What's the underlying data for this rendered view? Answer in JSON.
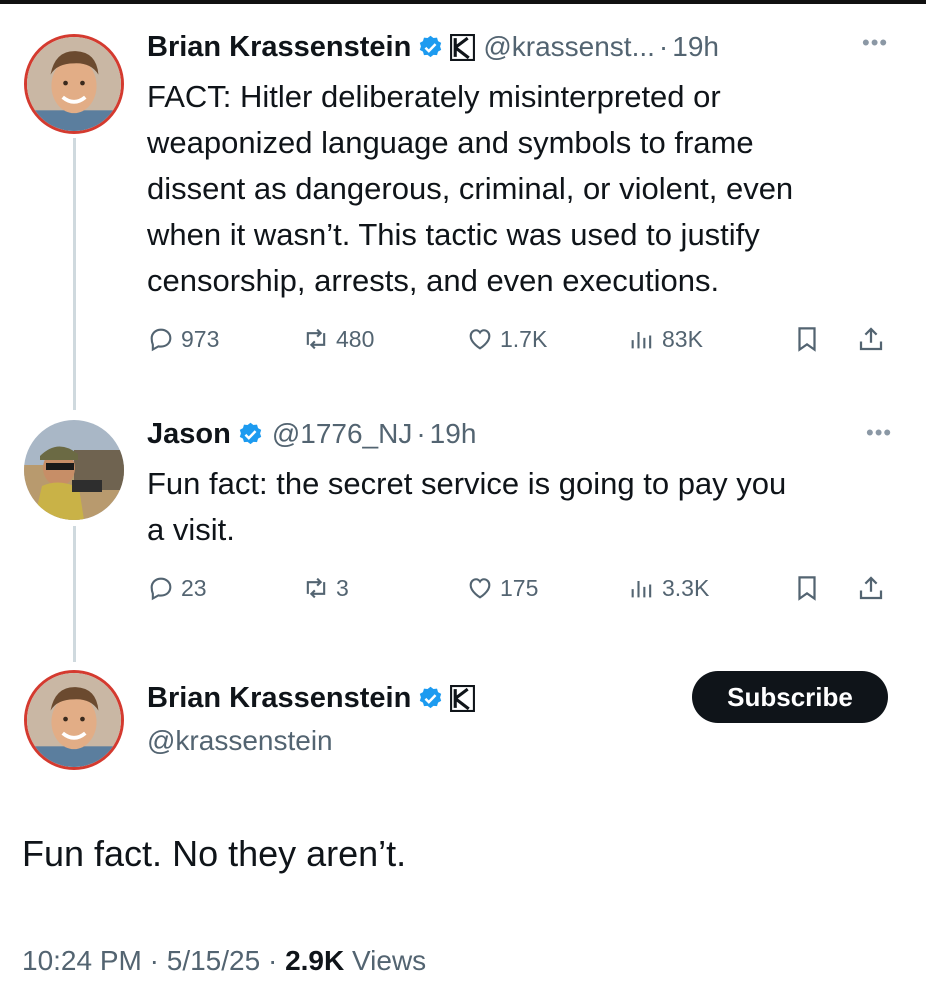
{
  "tweets": [
    {
      "name": "Brian Krassenstein",
      "handle": "@krassenst...",
      "time": "19h",
      "text": [
        "FACT: Hitler deliberately misinterpreted or",
        "weaponized language and symbols to frame",
        "dissent as dangerous, criminal, or violent, even",
        "when it wasn’t. This tactic was used to justify",
        "censorship, arrests, and even executions."
      ],
      "replies": "973",
      "reposts": "480",
      "likes": "1.7K",
      "views": "83K"
    },
    {
      "name": "Jason",
      "handle": "@1776_NJ",
      "time": "19h",
      "text": [
        "Fun fact: the secret service is going to pay you",
        "a visit."
      ],
      "replies": "23",
      "reposts": "3",
      "likes": "175",
      "views": "3.3K"
    }
  ],
  "main": {
    "name": "Brian Krassenstein",
    "handle": "@krassenstein",
    "subscribe_label": "Subscribe",
    "text": "Fun fact. No they aren’t.",
    "time": "10:24 PM",
    "date": "5/15/25",
    "views_count": "2.9K",
    "views_label": "Views",
    "separator": "·"
  },
  "icons": [
    "verified-badge-icon",
    "affiliate-k-icon",
    "more-icon",
    "reply-icon",
    "repost-icon",
    "like-icon",
    "views-icon",
    "bookmark-icon",
    "share-icon"
  ],
  "colors": {
    "verified": "#1d9bf0",
    "muted": "#536471",
    "text": "#0f1419",
    "avatar_ring": "#d43a2f"
  }
}
